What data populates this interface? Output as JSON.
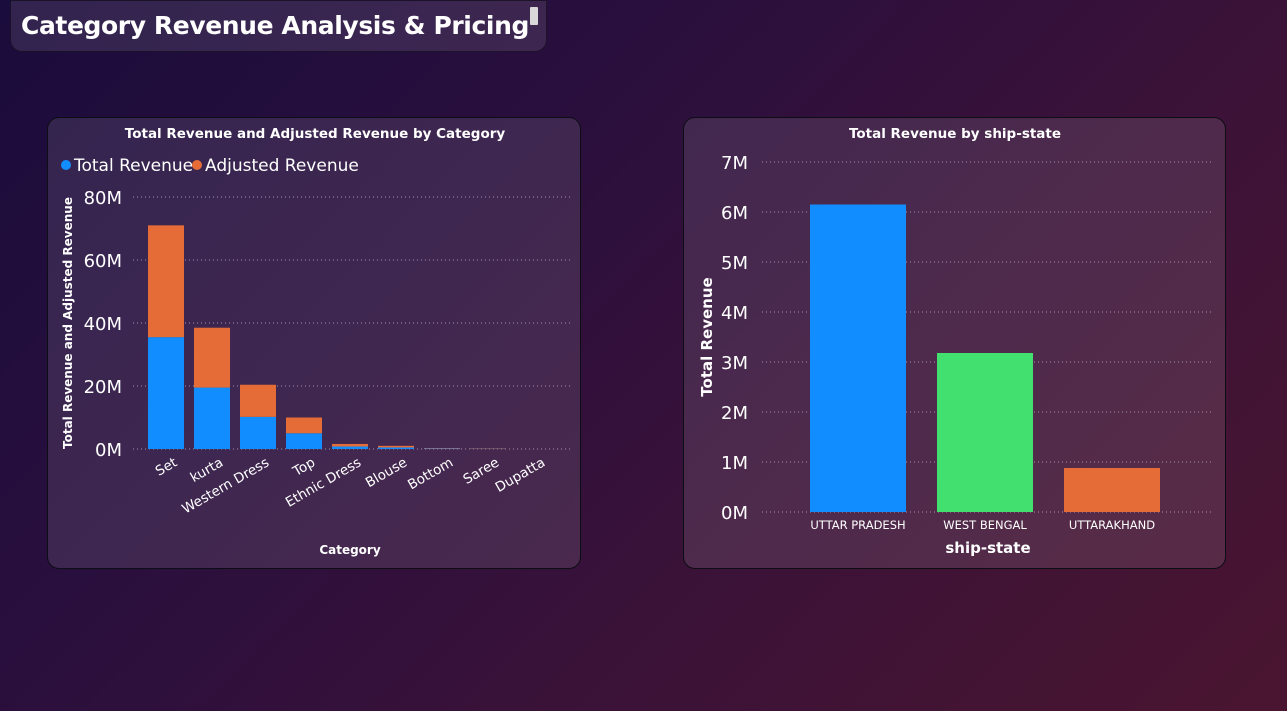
{
  "page": {
    "title": "Category Revenue Analysis & Pricing"
  },
  "colors": {
    "blue": "#118dff",
    "orange": "#e66c37",
    "green": "#42e06e"
  },
  "chart_data": [
    {
      "type": "bar",
      "stacked": true,
      "title": "Total Revenue and Adjusted Revenue by Category",
      "xlabel": "Category",
      "ylabel": "Total Revenue and Adjusted Revenue",
      "categories": [
        "Set",
        "kurta",
        "Western Dress",
        "Top",
        "Ethnic Dress",
        "Blouse",
        "Bottom",
        "Saree",
        "Dupatta"
      ],
      "series": [
        {
          "name": "Total Revenue",
          "color": "#118dff",
          "values": [
            35.5,
            19.5,
            10.2,
            5.0,
            0.8,
            0.5,
            0.15,
            0.1,
            0.0
          ]
        },
        {
          "name": "Adjusted Revenue",
          "color": "#e66c37",
          "values": [
            35.5,
            19.0,
            10.2,
            5.0,
            0.8,
            0.5,
            0.15,
            0.1,
            0.0
          ]
        }
      ],
      "yticks": [
        "0M",
        "20M",
        "40M",
        "60M",
        "80M"
      ],
      "ylim": [
        0,
        80
      ],
      "legend_position": "top-left",
      "grid": true
    },
    {
      "type": "bar",
      "title": "Total Revenue by ship-state",
      "xlabel": "ship-state",
      "ylabel": "Total Revenue",
      "categories": [
        "UTTAR PRADESH",
        "WEST BENGAL",
        "UTTARAKHAND"
      ],
      "values": [
        6.15,
        3.18,
        0.88
      ],
      "bar_colors": [
        "#118dff",
        "#42e06e",
        "#e66c37"
      ],
      "yticks": [
        "0M",
        "1M",
        "2M",
        "3M",
        "4M",
        "5M",
        "6M",
        "7M"
      ],
      "ylim": [
        0,
        7
      ],
      "grid": true
    }
  ]
}
